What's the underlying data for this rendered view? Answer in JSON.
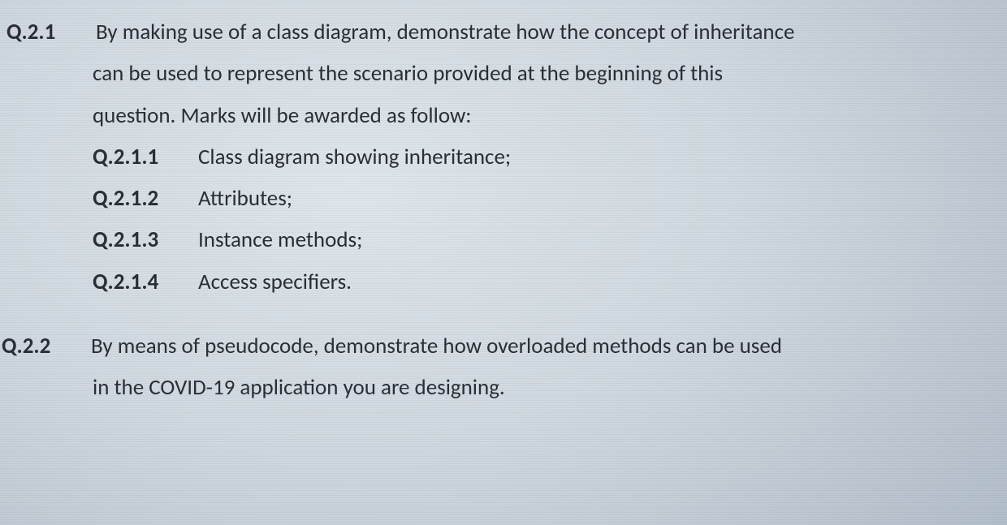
{
  "q21": {
    "num": "Q.2.1",
    "line1": "By making use of a class diagram, demonstrate how the concept of inheritance",
    "line2": "can be used to represent the scenario provided at the beginning of this",
    "line3": "question. Marks will be awarded as follow:",
    "subs": [
      {
        "num": "Q.2.1.1",
        "text": "Class diagram showing inheritance;"
      },
      {
        "num": "Q.2.1.2",
        "text": "Attributes;"
      },
      {
        "num": "Q.2.1.3",
        "text": "Instance methods;"
      },
      {
        "num": "Q.2.1.4",
        "text": "Access specifiers."
      }
    ]
  },
  "q22": {
    "num": "Q.2.2",
    "line1": "By means of pseudocode, demonstrate how overloaded methods can be used",
    "line2": "in the COVID-19 application you are designing."
  }
}
